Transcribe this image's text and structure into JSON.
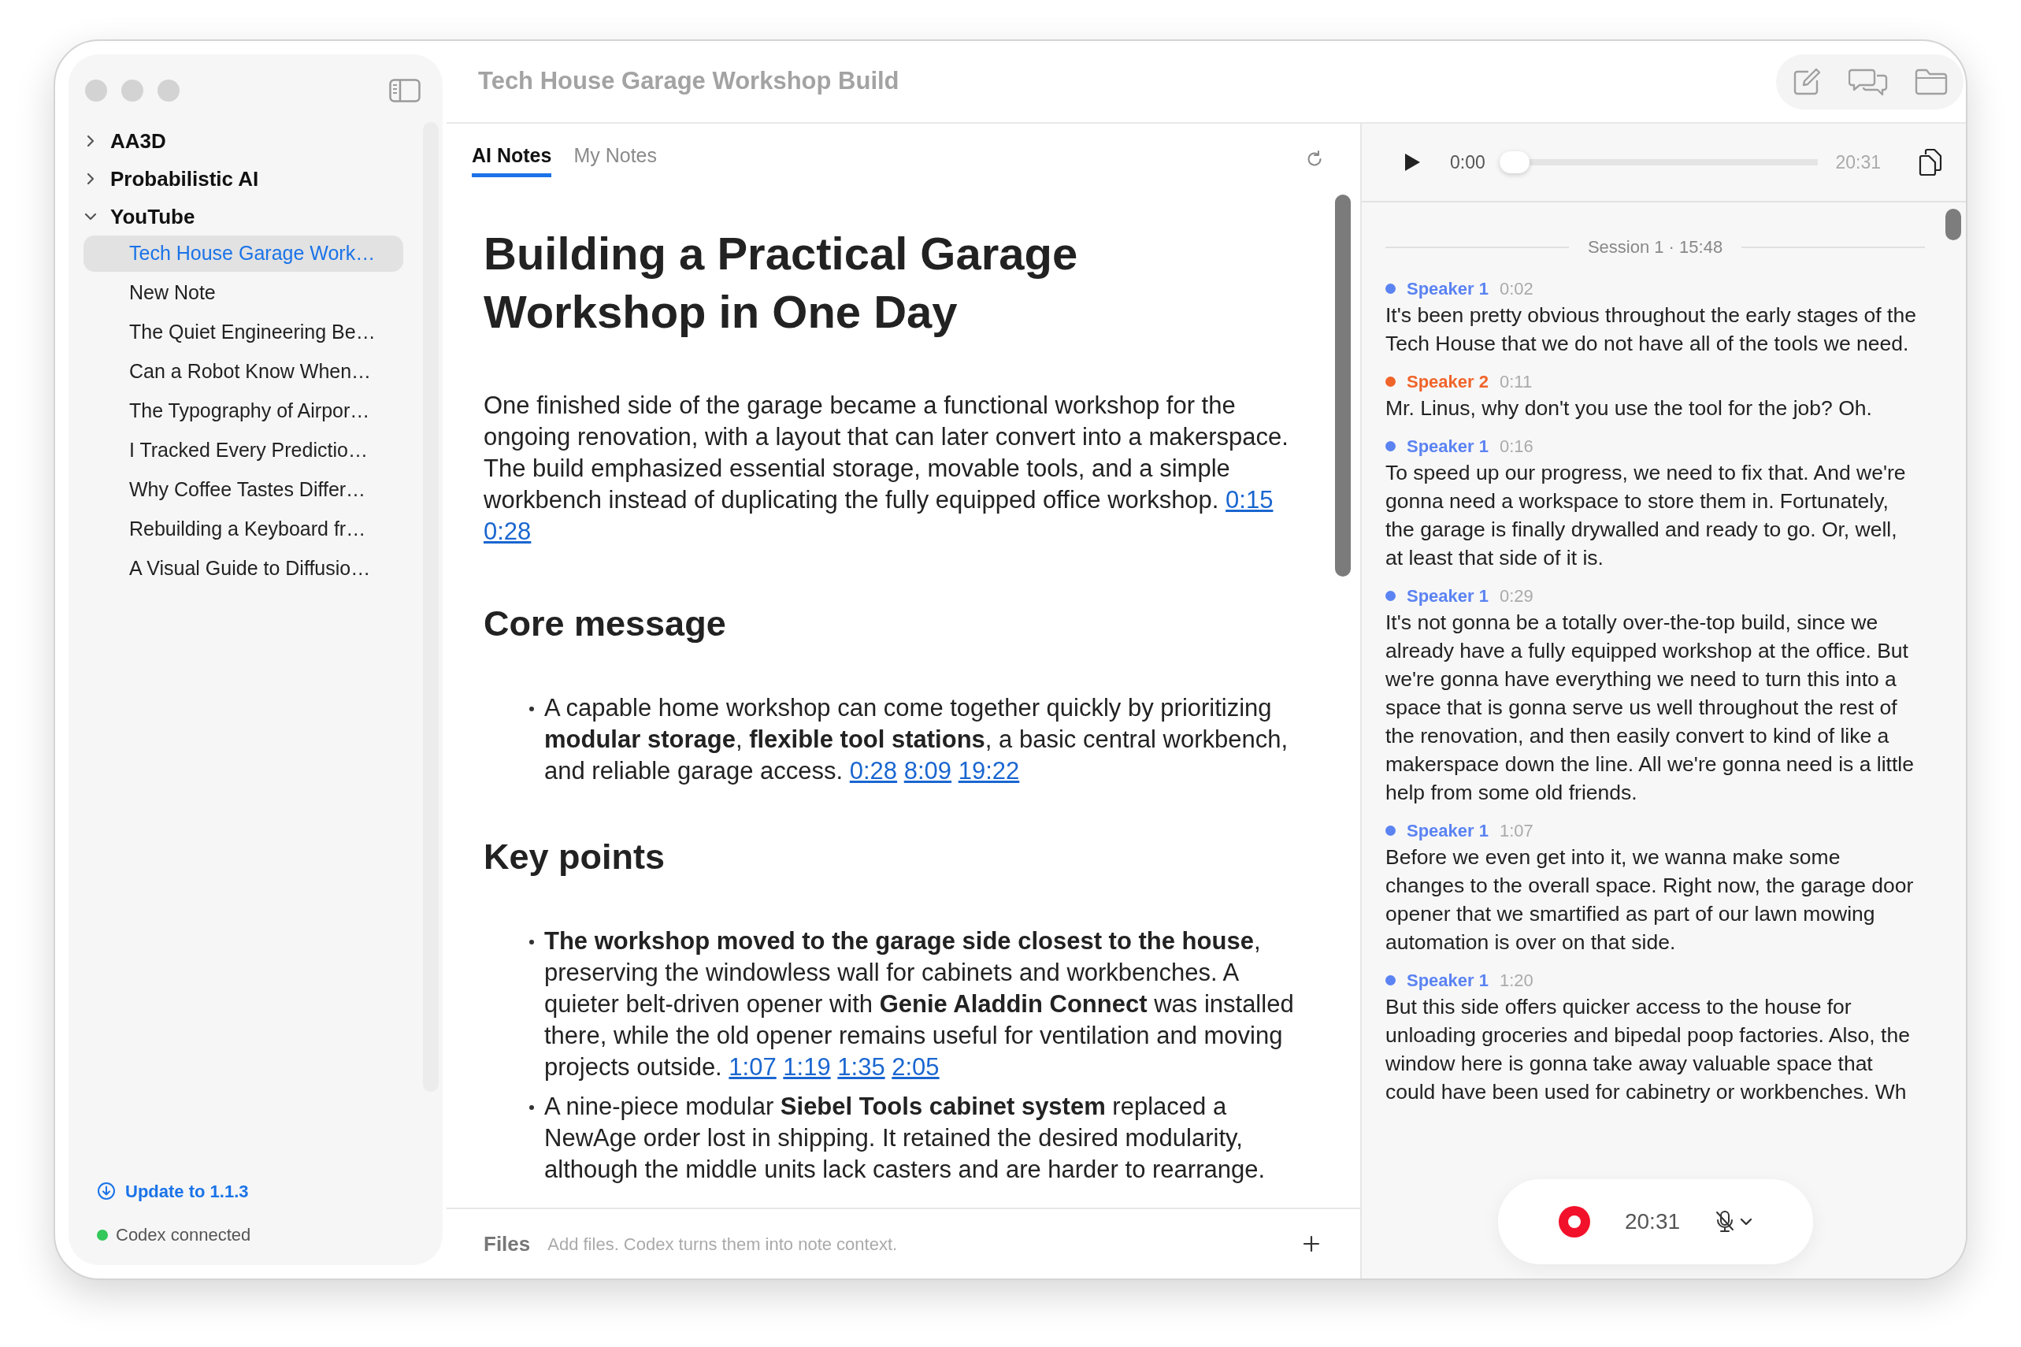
{
  "window": {
    "title": "Tech House Garage Workshop Build"
  },
  "sidebar": {
    "tree": [
      {
        "label": "AA3D",
        "expanded": false
      },
      {
        "label": "Probabilistic AI",
        "expanded": false
      },
      {
        "label": "YouTube",
        "expanded": true,
        "children": [
          {
            "label": "Tech House Garage Work…",
            "selected": true
          },
          {
            "label": "New Note",
            "selected": false
          },
          {
            "label": "The Quiet Engineering Be…",
            "selected": false
          },
          {
            "label": "Can a Robot Know When…",
            "selected": false
          },
          {
            "label": "The Typography of Airpor…",
            "selected": false
          },
          {
            "label": "I Tracked Every Predictio…",
            "selected": false
          },
          {
            "label": "Why Coffee Tastes Differ…",
            "selected": false
          },
          {
            "label": "Rebuilding a Keyboard fr…",
            "selected": false
          },
          {
            "label": "A Visual Guide to Diffusio…",
            "selected": false
          }
        ]
      }
    ],
    "update_link": "Update to 1.1.3",
    "status": {
      "text": "Codex connected",
      "connected": true
    }
  },
  "tabs": [
    {
      "label": "AI Notes",
      "selected": true
    },
    {
      "label": "My Notes",
      "selected": false
    }
  ],
  "note": {
    "title": "Building a Practical Garage Workshop in One Day",
    "blocks": [
      {
        "kind": "paragraph",
        "text": "One finished side of the garage became a functional workshop for the ongoing renovation, with a layout that can later convert into a makerspace. The build emphasized essential storage, movable tools, and a simple workbench instead of duplicating the fully equipped office workshop.",
        "links": [
          "0:15",
          "0:28"
        ]
      },
      {
        "kind": "heading",
        "text": "Core message"
      },
      {
        "kind": "bullets",
        "items": [
          {
            "text": "A capable home workshop can come together quickly by prioritizing **modular storage**, **flexible tool stations**, a basic central workbench, and reliable garage access.",
            "links": [
              "0:28",
              "8:09",
              "19:22"
            ]
          }
        ]
      },
      {
        "kind": "heading",
        "text": "Key points"
      },
      {
        "kind": "bullets",
        "items": [
          {
            "text": "**The workshop moved to the garage side closest to the house**, preserving the windowless wall for cabinets and workbenches. A quieter belt-driven opener with **Genie Aladdin Connect** was installed there, while the old opener remains useful for ventilation and moving projects outside.",
            "links": [
              "1:07",
              "1:19",
              "1:35",
              "2:05"
            ]
          },
          {
            "text": "A nine-piece modular **Siebel Tools cabinet system** replaced a NewAge order lost in shipping. It retained the desired modularity, although the middle units lack casters and are harder to rearrange."
          }
        ]
      }
    ]
  },
  "files_bar": {
    "label": "Files",
    "placeholder": "Add files. Codex turns them into note context."
  },
  "player": {
    "current": "0:00",
    "level": 0,
    "duration": "20:31"
  },
  "transcript": {
    "session": "Session 1 · 15:48",
    "entries": [
      {
        "speaker": "Speaker 1",
        "time": "0:02",
        "color": "#5b83f2",
        "text": "It's been pretty obvious throughout the early stages of the Tech House that we do not have all of the tools we need."
      },
      {
        "speaker": "Speaker 2",
        "time": "0:11",
        "color": "#f0642a",
        "text": "Mr. Linus, why don't you use the tool for the job? Oh."
      },
      {
        "speaker": "Speaker 1",
        "time": "0:16",
        "color": "#5b83f2",
        "text": "To speed up our progress, we need to fix that. And we're gonna need a workspace to store them in. Fortunately, the garage is finally drywalled and ready to go. Or, well, at least that side of it is."
      },
      {
        "speaker": "Speaker 1",
        "time": "0:29",
        "color": "#5b83f2",
        "text": "It's not gonna be a totally over-the-top build, since we already have a fully equipped workshop at the office. But we're gonna have everything we need to turn this into a space that is gonna serve us well throughout the rest of the renovation, and then easily convert to kind of like a makerspace down the line. All we're gonna need is a little help from some old friends."
      },
      {
        "speaker": "Speaker 1",
        "time": "1:07",
        "color": "#5b83f2",
        "text": "Before we even get into it, we wanna make some changes to the overall space. Right now, the garage door opener that we smartified as part of our lawn mowing automation is over on that side."
      },
      {
        "speaker": "Speaker 1",
        "time": "1:20",
        "color": "#5b83f2",
        "text": "But this side offers quicker access to the house for unloading groceries and bipedal poop factories. Also, the window here is gonna take away valuable space that could have been used for cabinetry or workbenches. Wh"
      }
    ]
  },
  "recorder": {
    "recording": true,
    "elapsed": "20:31",
    "muted": true
  }
}
